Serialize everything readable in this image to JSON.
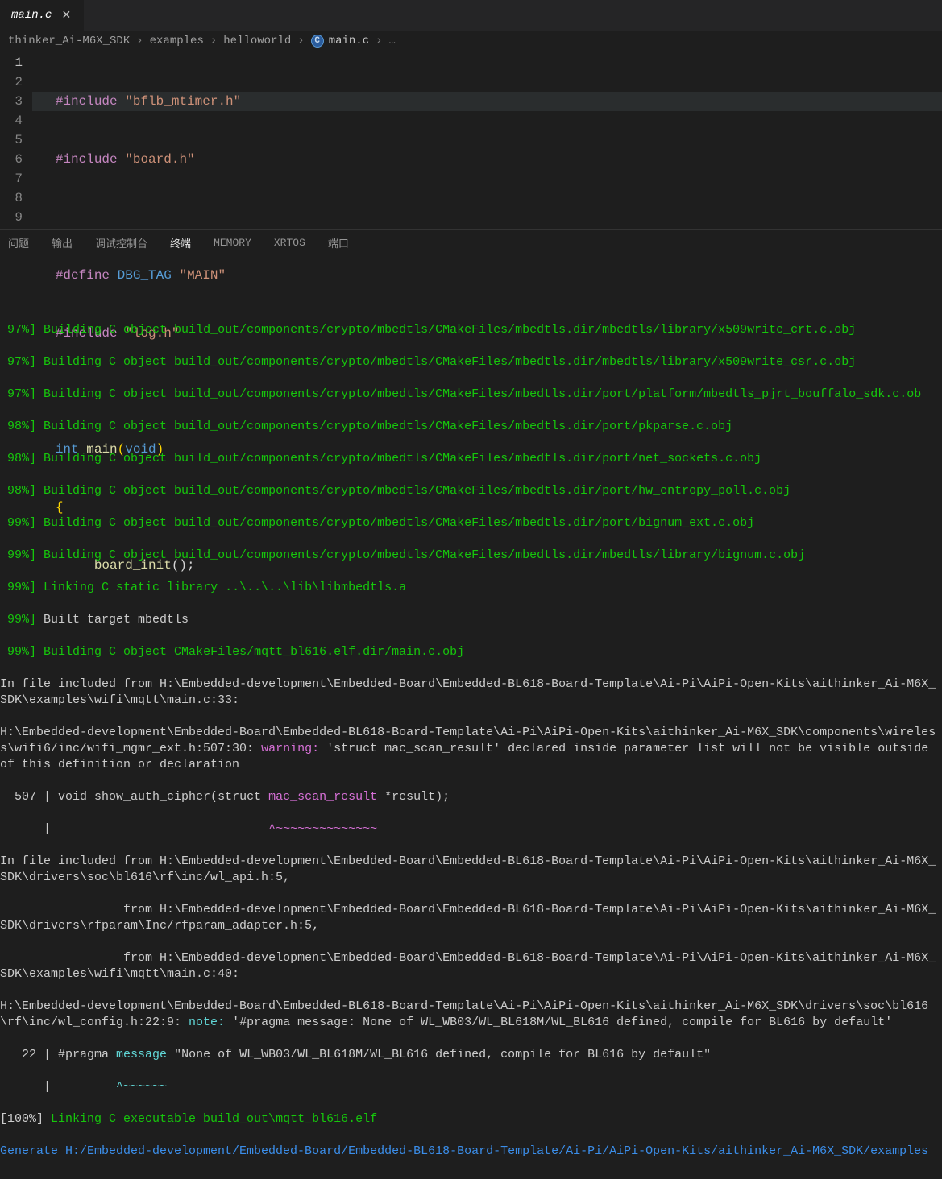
{
  "tab": {
    "label": "main.c"
  },
  "breadcrumb": {
    "seg1": "thinker_Ai-M6X_SDK",
    "seg2": "examples",
    "seg3": "helloworld",
    "seg4": "main.c",
    "trail": "…"
  },
  "gutter": [
    "1",
    "2",
    "3",
    "4",
    "5",
    "6",
    "7",
    "8",
    "9"
  ],
  "code": {
    "l1a": "#include",
    "l1b": "\"bflb_mtimer.h\"",
    "l2a": "#include",
    "l2b": "\"board.h\"",
    "l3": "",
    "l4a": "#define",
    "l4b": "DBG_TAG",
    "l4c": "\"MAIN\"",
    "l5a": "#include",
    "l5b": "\"log.h\"",
    "l6": "",
    "l7a": "int",
    "l7b": "main",
    "l7c": "(",
    "l7d": "void",
    "l7e": ")",
    "l8": "{",
    "l9a": "board_init",
    "l9b": "();"
  },
  "panelTabs": {
    "t1": "问题",
    "t2": "输出",
    "t3": "调试控制台",
    "t4": "终端",
    "t5": "MEMORY",
    "t6": "XRTOS",
    "t7": "端口"
  },
  "term": {
    "b1p": " 97%]",
    "b1t": " Building C object build_out/components/crypto/mbedtls/CMakeFiles/mbedtls.dir/mbedtls/library/x509write_crt.c.obj",
    "b2p": " 97%]",
    "b2t": " Building C object build_out/components/crypto/mbedtls/CMakeFiles/mbedtls.dir/mbedtls/library/x509write_csr.c.obj",
    "b3p": " 97%]",
    "b3t": " Building C object build_out/components/crypto/mbedtls/CMakeFiles/mbedtls.dir/port/platform/mbedtls_pjrt_bouffalo_sdk.c.ob",
    "b4p": " 98%]",
    "b4t": " Building C object build_out/components/crypto/mbedtls/CMakeFiles/mbedtls.dir/port/pkparse.c.obj",
    "b5p": " 98%]",
    "b5t": " Building C object build_out/components/crypto/mbedtls/CMakeFiles/mbedtls.dir/port/net_sockets.c.obj",
    "b6p": " 98%]",
    "b6t": " Building C object build_out/components/crypto/mbedtls/CMakeFiles/mbedtls.dir/port/hw_entropy_poll.c.obj",
    "b7p": " 99%]",
    "b7t": " Building C object build_out/components/crypto/mbedtls/CMakeFiles/mbedtls.dir/port/bignum_ext.c.obj",
    "b8p": " 99%]",
    "b8t": " Building C object build_out/components/crypto/mbedtls/CMakeFiles/mbedtls.dir/mbedtls/library/bignum.c.obj",
    "b9p": " 99%]",
    "b9t": " Linking C static library ..\\..\\..\\lib\\libmbedtls.a",
    "b10p": " 99%]",
    "b10t": " Built target mbedtls",
    "b11p": " 99%]",
    "b11t": " Building C object CMakeFiles/mqtt_bl616.elf.dir/main.c.obj",
    "inc1a": "In file included from ",
    "inc1b": "H:\\Embedded-development\\Embedded-Board\\Embedded-BL618-Board-Template\\Ai-Pi\\AiPi-Open-Kits\\aithinker_Ai-M6X_SDK\\examples\\wifi\\mqtt\\main.c:33",
    "inc1c": ":",
    "loc1": "H:\\Embedded-development\\Embedded-Board\\Embedded-BL618-Board-Template\\Ai-Pi\\AiPi-Open-Kits\\aithinker_Ai-M6X_SDK\\components\\wireless\\wifi6/inc/wifi_mgmr_ext.h:507:30:",
    "warn": " warning: ",
    "warnmsg": "'struct mac_scan_result' declared inside parameter list will not be visible outside of this definition or declaration",
    "codeline_num": "  507 | ",
    "codeline_a": "void show_auth_cipher(struct ",
    "codeline_b": "mac_scan_result",
    "codeline_c": " *result);",
    "underline_pre": "      |                              ",
    "underline": "^~~~~~~~~~~~~~~",
    "inc2a": "In file included from ",
    "inc2b": "H:\\Embedded-development\\Embedded-Board\\Embedded-BL618-Board-Template\\Ai-Pi\\AiPi-Open-Kits\\aithinker_Ai-M6X_SDK\\drivers\\soc\\bl616\\rf\\inc/wl_api.h:5",
    "inc2c": ",",
    "inc3a": "                 from ",
    "inc3b": "H:\\Embedded-development\\Embedded-Board\\Embedded-BL618-Board-Template\\Ai-Pi\\AiPi-Open-Kits\\aithinker_Ai-M6X_SDK\\drivers\\rfparam\\Inc/rfparam_adapter.h:5",
    "inc3c": ",",
    "inc4a": "                 from ",
    "inc4b": "H:\\Embedded-development\\Embedded-Board\\Embedded-BL618-Board-Template\\Ai-Pi\\AiPi-Open-Kits\\aithinker_Ai-M6X_SDK\\examples\\wifi\\mqtt\\main.c:40",
    "inc4c": ":",
    "loc2": "H:\\Embedded-development\\Embedded-Board\\Embedded-BL618-Board-Template\\Ai-Pi\\AiPi-Open-Kits\\aithinker_Ai-M6X_SDK\\drivers\\soc\\bl616\\rf\\inc/wl_config.h:22:9:",
    "note": " note: ",
    "notemsg": "'#pragma message: None of WL_WB03/WL_BL618M/WL_BL616 defined, compile for BL616 by default'",
    "codeline2_num": "   22 | ",
    "codeline2_a": "#pragma ",
    "codeline2_b": "message",
    "codeline2_c": " \"None of WL_WB03/WL_BL618M/WL_BL616 defined, compile for BL616 by default\"",
    "underline2_pre": "      |         ",
    "underline2": "^~~~~~~",
    "b12p": "[100%]",
    "b12t": " Linking C executable build_out\\mqtt_bl616.elf",
    "gen": "Generate H:/Embedded-development/Embedded-Board/Embedded-BL618-Board-Template/Ai-Pi/AiPi-Open-Kits/aithinker_Ai-M6X_SDK/examples"
  }
}
